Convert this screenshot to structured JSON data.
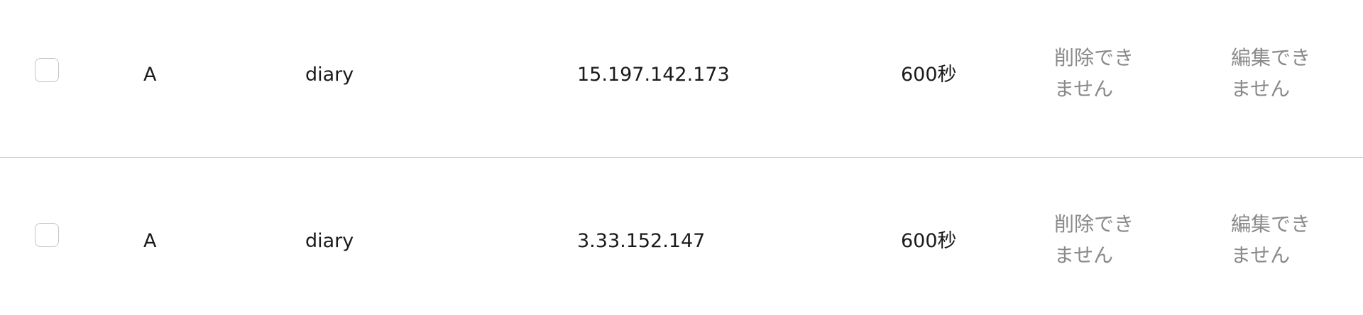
{
  "records": [
    {
      "type": "A",
      "name": "diary",
      "value": "15.197.142.173",
      "ttl": "600秒",
      "delete_label": "削除できません",
      "edit_label": "編集できません"
    },
    {
      "type": "A",
      "name": "diary",
      "value": "3.33.152.147",
      "ttl": "600秒",
      "delete_label": "削除できません",
      "edit_label": "編集できません"
    }
  ]
}
